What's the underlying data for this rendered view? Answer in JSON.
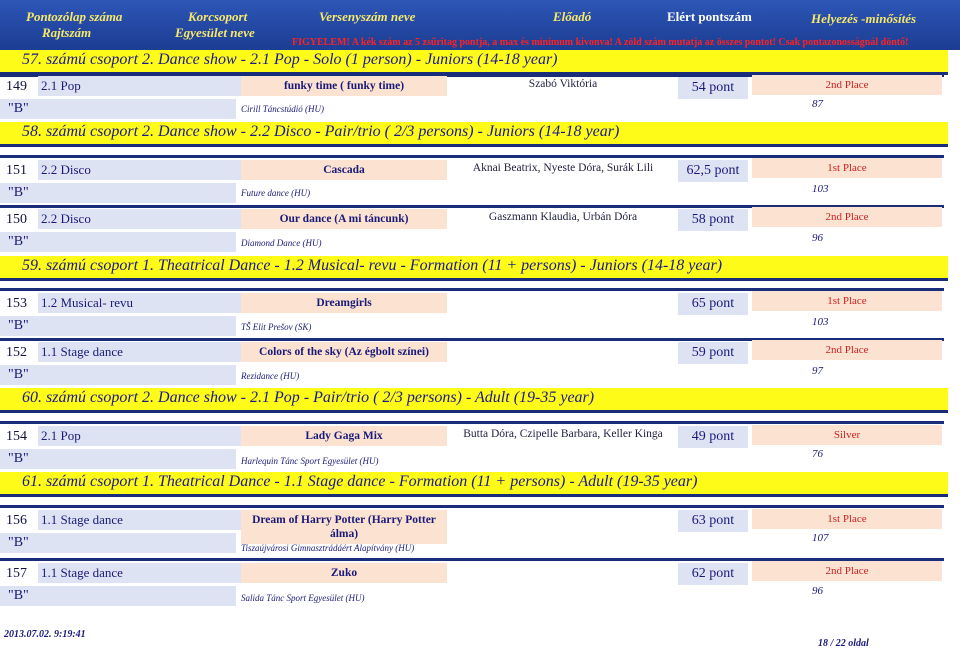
{
  "header": {
    "col1_line1": "Pontozólap száma",
    "col1_line2": "Rajtszám",
    "col2_line1": "Korcsoport",
    "col2_line2": "Egyesület neve",
    "col3": "Versenyszám neve",
    "col4": "Előadó",
    "col5": "Elért pontszám",
    "col6": "Helyezés -minősítés",
    "warning": "FIGYELEM! A kék szám az 5 zsűritag pontja, a max és minimum kivonva! A zöld szám mutatja az összes pontot! Csak pontazonosságnál döntő!"
  },
  "groups": [
    {
      "title": "57. számú csoport   2. Dance show - 2.1 Pop - Solo (1 person) - Juniors (14-18 year)",
      "entries": [
        {
          "num": "149",
          "category": "2.1 Pop",
          "dance": "funky time ( funky time)",
          "performer": "Szabó Viktória",
          "points": "54 pont",
          "place": "2nd Place",
          "quality": "\"B\"",
          "club": "Cirill Táncstúdió (HU)",
          "score": "87"
        }
      ]
    },
    {
      "title": "58. számú csoport  2. Dance show - 2.2 Disco - Pair/trio ( 2/3 persons) - Juniors (14-18 year)",
      "entries": [
        {
          "num": "151",
          "category": "2.2 Disco",
          "dance": "Cascada",
          "performer": "Aknai Beatrix, Nyeste Dóra, Surák Lili",
          "points": "62,5 pont",
          "place": "1st Place",
          "quality": "\"B\"",
          "club": "Future dance (HU)",
          "score": "103"
        },
        {
          "num": "150",
          "category": "2.2 Disco",
          "dance": "Our dance (A mi táncunk)",
          "performer": "Gaszmann Klaudia, Urbán Dóra",
          "points": "58 pont",
          "place": "2nd Place",
          "quality": "\"B\"",
          "club": "Diamond Dance (HU)",
          "score": "96"
        }
      ]
    },
    {
      "title": "59. számú csoport   1. Theatrical Dance - 1.2 Musical- revu - Formation (11 + persons) - Juniors (14-18 year)",
      "entries": [
        {
          "num": "153",
          "category": "1.2 Musical- revu",
          "dance": "Dreamgirls",
          "performer": "",
          "points": "65 pont",
          "place": "1st Place",
          "quality": "\"B\"",
          "club": "TŠ Elit Prešov (SK)",
          "score": "103"
        },
        {
          "num": "152",
          "category": "1.1 Stage dance",
          "dance": "Colors of the sky (Az égbolt színei)",
          "performer": "",
          "points": "59 pont",
          "place": "2nd Place",
          "quality": "\"B\"",
          "club": "Rezidance (HU)",
          "score": "97"
        }
      ]
    },
    {
      "title": "60. számú csoport   2. Dance show - 2.1 Pop - Pair/trio ( 2/3 persons) - Adult (19-35 year)",
      "entries": [
        {
          "num": "154",
          "category": "2.1 Pop",
          "dance": "Lady Gaga Mix",
          "performer": "Butta Dóra, Czipelle Barbara, Keller Kinga",
          "points": "49 pont",
          "place": "Silver",
          "quality": "\"B\"",
          "club": "Harlequin Tánc Sport Egyesület (HU)",
          "score": "76"
        }
      ]
    },
    {
      "title": "61. számú csoport   1. Theatrical Dance - 1.1 Stage dance - Formation (11 + persons) - Adult (19-35 year)",
      "entries": [
        {
          "num": "156",
          "category": "1.1 Stage dance",
          "dance": "Dream of Harry Potter (Harry Potter álma)",
          "performer": "",
          "points": "63 pont",
          "place": "1st Place",
          "quality": "\"B\"",
          "club": "Tiszaújvárosi Gimnasztrádáért Alapítvány (HU)",
          "score": "107"
        },
        {
          "num": "157",
          "category": "1.1 Stage dance",
          "dance": "Zuko",
          "performer": "",
          "points": "62 pont",
          "place": "2nd Place",
          "quality": "\"B\"",
          "club": "Salida Tánc Sport Egyesület (HU)",
          "score": "96"
        }
      ]
    }
  ],
  "footer": {
    "timestamp": "2013.07.02. 9:19:41",
    "page": "18 / 22 oldal"
  }
}
